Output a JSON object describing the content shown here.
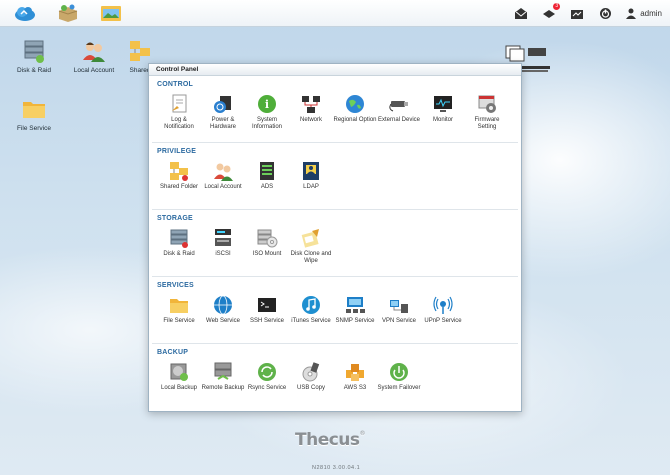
{
  "topbar": {
    "apps": [
      {
        "name": "cloud-app-icon"
      },
      {
        "name": "package-app-icon"
      },
      {
        "name": "folder-app-icon"
      }
    ],
    "notification_count": "3",
    "user_label": "admin"
  },
  "desktop": {
    "icons": [
      {
        "label": "Disk & Raid"
      },
      {
        "label": "Local Account"
      },
      {
        "label": "Shared"
      },
      {
        "label": "File Service"
      }
    ]
  },
  "control_panel": {
    "title": "Control Panel",
    "sections": [
      {
        "title": "CONTROL",
        "items": [
          {
            "label": "Log & Notification",
            "icon": "log-notification-icon"
          },
          {
            "label": "Power & Hardware",
            "icon": "power-hardware-icon"
          },
          {
            "label": "System Information",
            "icon": "system-information-icon"
          },
          {
            "label": "Network",
            "icon": "network-icon"
          },
          {
            "label": "Regional Option",
            "icon": "regional-option-icon"
          },
          {
            "label": "External Device",
            "icon": "external-device-icon"
          },
          {
            "label": "Monitor",
            "icon": "monitor-icon"
          },
          {
            "label": "Firmware Setting",
            "icon": "firmware-setting-icon"
          }
        ]
      },
      {
        "title": "PRIVILEGE",
        "items": [
          {
            "label": "Shared Folder",
            "icon": "shared-folder-icon"
          },
          {
            "label": "Local Account",
            "icon": "local-account-icon"
          },
          {
            "label": "ADS",
            "icon": "ads-icon"
          },
          {
            "label": "LDAP",
            "icon": "ldap-icon"
          }
        ]
      },
      {
        "title": "STORAGE",
        "items": [
          {
            "label": "Disk & Raid",
            "icon": "disk-raid-icon"
          },
          {
            "label": "iSCSI",
            "icon": "iscsi-icon"
          },
          {
            "label": "ISO Mount",
            "icon": "iso-mount-icon"
          },
          {
            "label": "Disk Clone and Wipe",
            "icon": "disk-clone-icon"
          }
        ]
      },
      {
        "title": "SERVICES",
        "items": [
          {
            "label": "File Service",
            "icon": "file-service-icon"
          },
          {
            "label": "Web Service",
            "icon": "web-service-icon"
          },
          {
            "label": "SSH Service",
            "icon": "ssh-service-icon"
          },
          {
            "label": "iTunes Service",
            "icon": "itunes-service-icon"
          },
          {
            "label": "SNMP Service",
            "icon": "snmp-service-icon"
          },
          {
            "label": "VPN Service",
            "icon": "vpn-service-icon"
          },
          {
            "label": "UPnP Service",
            "icon": "upnp-service-icon"
          }
        ]
      },
      {
        "title": "BACKUP",
        "items": [
          {
            "label": "Local Backup",
            "icon": "local-backup-icon"
          },
          {
            "label": "Remote Backup",
            "icon": "remote-backup-icon"
          },
          {
            "label": "Rsync Service",
            "icon": "rsync-service-icon"
          },
          {
            "label": "USB Copy",
            "icon": "usb-copy-icon"
          },
          {
            "label": "AWS S3",
            "icon": "aws-s3-icon"
          },
          {
            "label": "System Failover",
            "icon": "system-failover-icon"
          }
        ]
      }
    ]
  },
  "footer": {
    "brand": "Thecus",
    "version": "N2810   3.00.04.1"
  }
}
